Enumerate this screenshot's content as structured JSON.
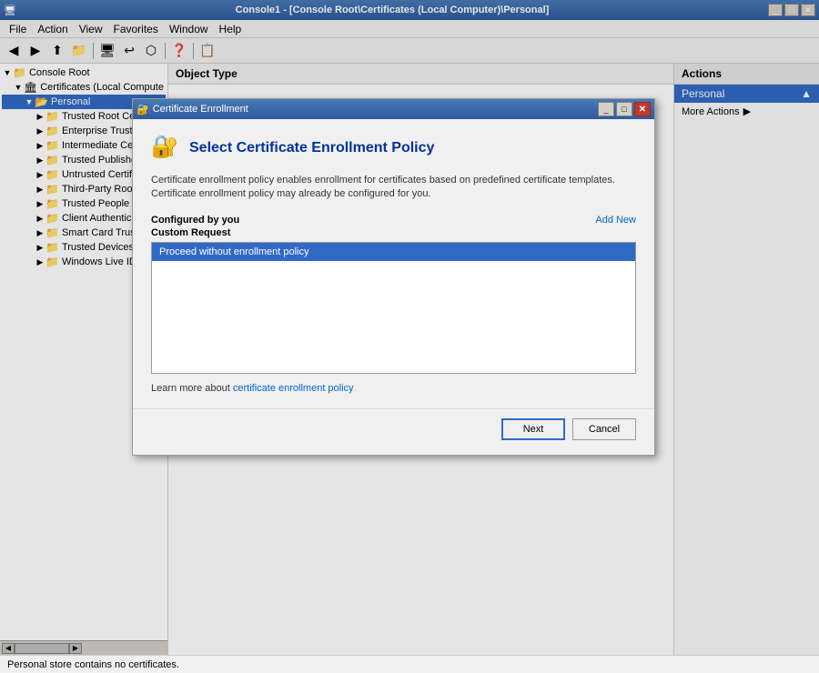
{
  "window": {
    "title": "Console1 - [Console Root\\Certificates (Local Computer)\\Personal]",
    "logo": "🖥"
  },
  "menu": {
    "items": [
      "File",
      "Action",
      "View",
      "Favorites",
      "Window",
      "Help"
    ]
  },
  "toolbar": {
    "buttons": [
      "◀",
      "▶",
      "⬆",
      "📁",
      "🖥",
      "↩",
      "⬡",
      "❓",
      "📋"
    ]
  },
  "tree": {
    "items": [
      {
        "label": "Console Root",
        "level": 0,
        "expanded": true,
        "selected": false
      },
      {
        "label": "Certificates (Local Compute",
        "level": 1,
        "expanded": true,
        "selected": false
      },
      {
        "label": "Personal",
        "level": 2,
        "expanded": true,
        "selected": true
      },
      {
        "label": "Trusted Root Ce...",
        "level": 3,
        "selected": false
      },
      {
        "label": "Enterprise Trust",
        "level": 3,
        "selected": false
      },
      {
        "label": "Intermediate Ce...",
        "level": 3,
        "selected": false
      },
      {
        "label": "Trusted Publishe...",
        "level": 3,
        "selected": false
      },
      {
        "label": "Untrusted Certifi...",
        "level": 3,
        "selected": false
      },
      {
        "label": "Third-Party Root...",
        "level": 3,
        "selected": false
      },
      {
        "label": "Trusted People",
        "level": 3,
        "selected": false
      },
      {
        "label": "Client Authentic...",
        "level": 3,
        "selected": false
      },
      {
        "label": "Smart Card Trus...",
        "level": 3,
        "selected": false
      },
      {
        "label": "Trusted Devices",
        "level": 3,
        "selected": false
      },
      {
        "label": "Windows Live ID...",
        "level": 3,
        "selected": false
      }
    ]
  },
  "content": {
    "column_header": "Object Type"
  },
  "actions": {
    "panel_title": "Actions",
    "section_label": "Personal",
    "more_actions": "More Actions"
  },
  "status_bar": {
    "text": "Personal store contains no certificates."
  },
  "dialog": {
    "title": "Certificate Enrollment",
    "icon": "🔐",
    "main_title": "Select Certificate Enrollment Policy",
    "description_line1": "Certificate enrollment policy enables enrollment for certificates based on predefined certificate templates.",
    "description_line2": "Certificate enrollment policy may already be configured for you.",
    "configured_by_label": "Configured by you",
    "add_new_label": "Add New",
    "custom_request_label": "Custom Request",
    "policy_items": [
      {
        "label": "Proceed without enrollment policy",
        "selected": true
      }
    ],
    "learn_more_text": "Learn more about ",
    "learn_more_link": "certificate enrollment policy",
    "next_button": "Next",
    "cancel_button": "Cancel"
  }
}
